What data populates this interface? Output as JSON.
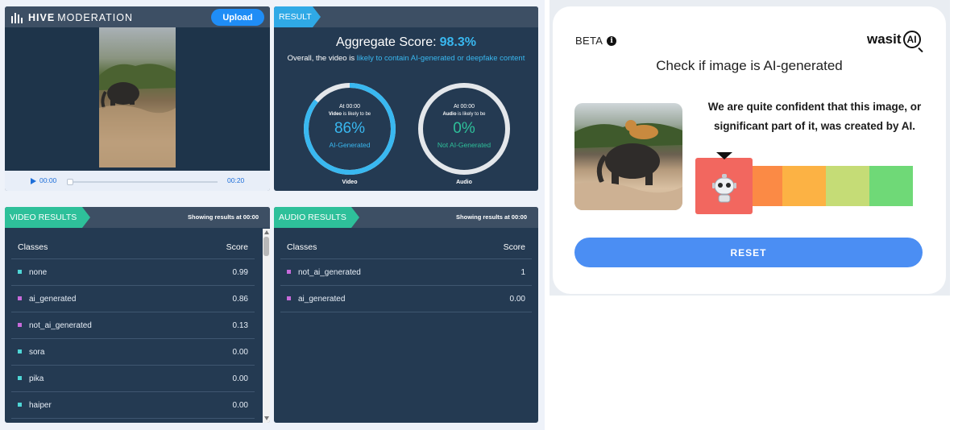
{
  "hive": {
    "brand": {
      "bold": "HIVE",
      "rest": "MODERATION"
    },
    "upload_label": "Upload",
    "player": {
      "current_time": "00:00",
      "duration": "00:20",
      "progress": 0.0
    },
    "result": {
      "tag": "RESULT",
      "aggregate_label": "Aggregate Score:",
      "aggregate_value": "98.3%",
      "desc_prefix": "Overall, the video is",
      "desc_highlight": "likely to contain AI-generated or deepfake content",
      "video_gauge": {
        "at": "At 00:00",
        "sub_bold": "Video",
        "sub_rest": "is likely to be",
        "percent": "86%",
        "value": 0.86,
        "label": "AI-Generated",
        "caption": "Video",
        "color": "#39b8f0"
      },
      "audio_gauge": {
        "at": "At 00:00",
        "sub_bold": "Audio",
        "sub_rest": "is likely to be",
        "percent": "0%",
        "value": 0.0,
        "label": "Not AI-Generated",
        "caption": "Audio",
        "color": "#2ec09a"
      }
    },
    "video_results": {
      "tag": "VIDEO RESULTS",
      "showing": "Showing results at 00:00",
      "header_class": "Classes",
      "header_score": "Score",
      "rows": [
        {
          "cls": "none",
          "score": "0.99",
          "color": "#4fd6d6"
        },
        {
          "cls": "ai_generated",
          "score": "0.86",
          "color": "#c86bdb"
        },
        {
          "cls": "not_ai_generated",
          "score": "0.13",
          "color": "#c86bdb"
        },
        {
          "cls": "sora",
          "score": "0.00",
          "color": "#4fd6d6"
        },
        {
          "cls": "pika",
          "score": "0.00",
          "color": "#4fd6d6"
        },
        {
          "cls": "haiper",
          "score": "0.00",
          "color": "#4fd6d6"
        }
      ]
    },
    "audio_results": {
      "tag": "AUDIO RESULTS",
      "showing": "Showing results at 00:00",
      "header_class": "Classes",
      "header_score": "Score",
      "rows": [
        {
          "cls": "not_ai_generated",
          "score": "1",
          "color": "#c86bdb"
        },
        {
          "cls": "ai_generated",
          "score": "0.00",
          "color": "#c86bdb"
        }
      ]
    }
  },
  "wasitai": {
    "beta": "BETA",
    "logo_text": "wasit",
    "logo_ai": "AI",
    "title": "Check if image is AI-generated",
    "message": "We are quite confident that this image, or significant part of it, was created by AI.",
    "scale_colors": [
      "#f2675f",
      "#fb8a45",
      "#fcb244",
      "#c5dc76",
      "#6fd977"
    ],
    "active_level": 1,
    "reset_label": "RESET"
  }
}
